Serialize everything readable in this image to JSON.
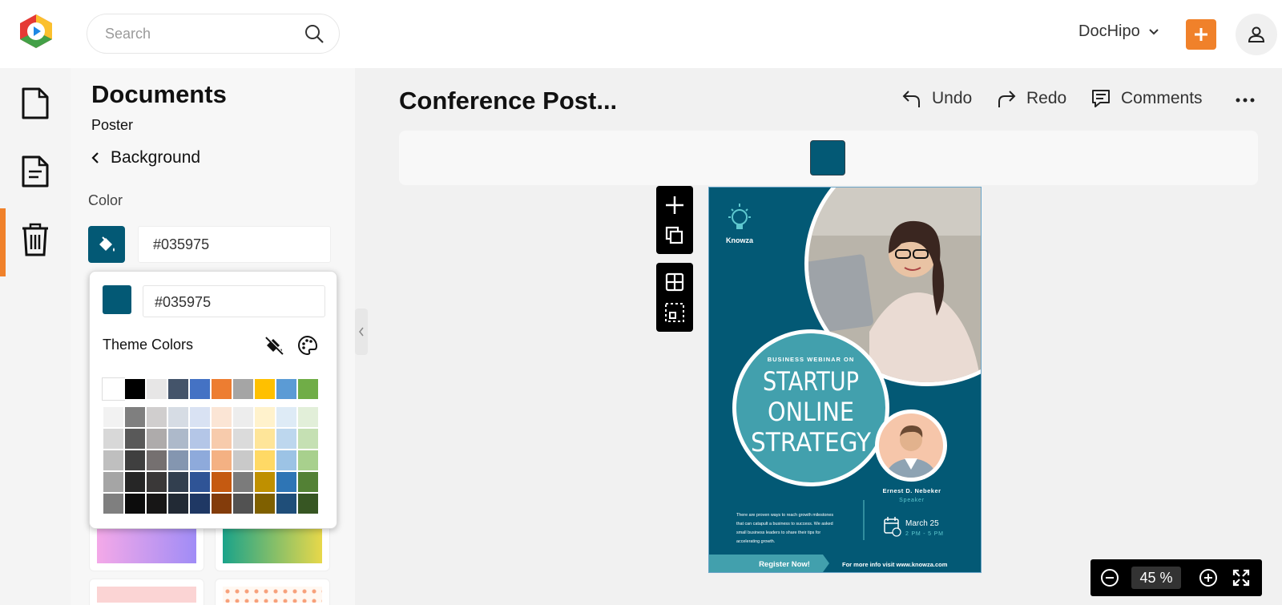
{
  "header": {
    "search_placeholder": "Search",
    "account_label": "DocHipo"
  },
  "sidebar": {
    "items": [
      {
        "name": "documents",
        "icon": "document-icon"
      },
      {
        "name": "my-documents",
        "icon": "document-lines-icon",
        "active": true
      },
      {
        "name": "trash",
        "icon": "trash-icon"
      }
    ]
  },
  "panel": {
    "title": "Documents",
    "subtitle": "Poster",
    "back_label": "Background",
    "color_label": "Color",
    "hex_value": "#035975"
  },
  "picker": {
    "hex_value": "#035975",
    "theme_label": "Theme Colors",
    "theme_row": [
      "#ffffff",
      "#000000",
      "#e7e6e6",
      "#44546a",
      "#4472c4",
      "#ed7d31",
      "#a5a5a5",
      "#ffc000",
      "#5b9bd5",
      "#70ad47"
    ],
    "shades": [
      [
        "#f2f2f2",
        "#7f7f7f",
        "#d0cece",
        "#d6dce4",
        "#d9e2f3",
        "#fbe5d5",
        "#ededed",
        "#fff2cc",
        "#deebf6",
        "#e2efd9"
      ],
      [
        "#d8d8d8",
        "#595959",
        "#aeabab",
        "#adb9ca",
        "#b4c6e7",
        "#f7cbac",
        "#dbdbdb",
        "#fee599",
        "#bdd7ee",
        "#c5e0b3"
      ],
      [
        "#bfbfbf",
        "#3f3f3f",
        "#757070",
        "#8496b0",
        "#8eaadb",
        "#f4b183",
        "#c9c9c9",
        "#ffd965",
        "#9cc3e5",
        "#a8d08d"
      ],
      [
        "#a5a5a5",
        "#262626",
        "#3a3838",
        "#323f4f",
        "#2f5496",
        "#c55a11",
        "#7b7b7b",
        "#bf9000",
        "#2e75b5",
        "#538135"
      ],
      [
        "#7f7f7f",
        "#0c0c0c",
        "#171616",
        "#222a35",
        "#1f3864",
        "#833c0b",
        "#525252",
        "#7f6000",
        "#1f4e79",
        "#375623"
      ]
    ]
  },
  "editor": {
    "doc_title": "Conference Post...",
    "undo_label": "Undo",
    "redo_label": "Redo",
    "comments_label": "Comments",
    "bg_color": "#035975"
  },
  "poster": {
    "brand": "Knowza",
    "eyebrow": "BUSINESS WEBINAR ON",
    "headline_1": "STARTUP",
    "headline_2": "ONLINE",
    "headline_3": "STRATEGY",
    "speaker_name": "Ernest D. Nebeker",
    "speaker_role": "Speaker",
    "body_1": "There are proven ways to reach growth milestones",
    "body_2": "that can catapult a business to success. We asked",
    "body_3": "small business leaders to share their tips for",
    "body_4": "accelerating growth.",
    "date": "March 25",
    "time": "2 PM - 5 PM",
    "cta": "Register Now!",
    "footer": "For more info visit www.knowza.com"
  },
  "zoom": {
    "value": "45",
    "unit": "%"
  },
  "colors": {
    "accent": "#f0812a",
    "poster_bg": "#035975",
    "teal": "#42a0ad",
    "grad_pink": [
      "#f4a9e8",
      "#a08cf6"
    ],
    "grad_teal": [
      "#1aa38a",
      "#e8d84a"
    ]
  }
}
